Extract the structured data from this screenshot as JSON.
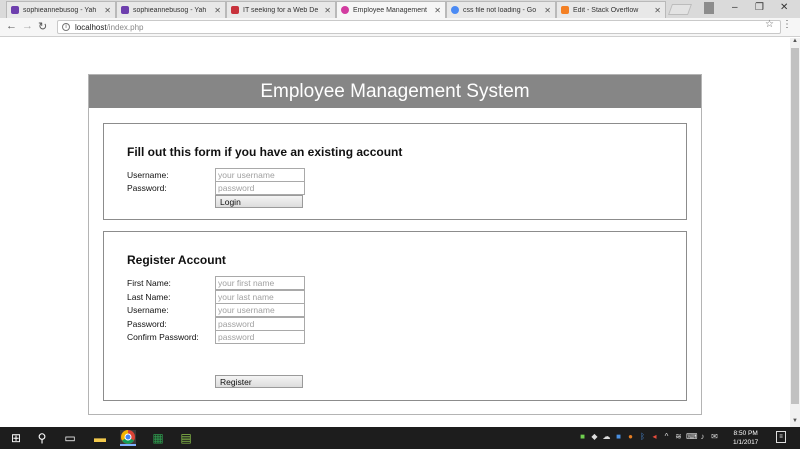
{
  "browser": {
    "tabs": [
      {
        "title": "sophieannebusog - Yah",
        "icon_color": "#6e3fae"
      },
      {
        "title": "sophieannebusog - Yah",
        "icon_color": "#6e3fae"
      },
      {
        "title": "IT seeking for a Web De",
        "icon_color": "#c8323c"
      },
      {
        "title": "Employee Management",
        "icon_color": "#d23ca0"
      },
      {
        "title": "css file not loading - Go",
        "icon_color": "#4a8af4"
      },
      {
        "title": "Edit - Stack Overflow",
        "icon_color": "#f48024"
      }
    ],
    "active_tab_index": 3,
    "url_host": "localhost",
    "url_path": "/index.php"
  },
  "page": {
    "header": "Employee Management System",
    "login": {
      "heading": "Fill out this form if you have an existing account",
      "fields": [
        {
          "label": "Username:",
          "placeholder": "your username",
          "value": ""
        },
        {
          "label": "Password:",
          "placeholder": "password",
          "value": ""
        }
      ],
      "button": "Login"
    },
    "register": {
      "heading": "Register Account",
      "fields": [
        {
          "label": "First Name:",
          "placeholder": "your first name",
          "value": ""
        },
        {
          "label": "Last Name:",
          "placeholder": "your last name",
          "value": ""
        },
        {
          "label": "Username:",
          "placeholder": "your username",
          "value": ""
        },
        {
          "label": "Password:",
          "placeholder": "password",
          "value": ""
        },
        {
          "label": "Confirm Password:",
          "placeholder": "password",
          "value": ""
        }
      ],
      "button": "Register"
    }
  },
  "taskbar": {
    "time": "8:50 PM",
    "date": "1/1/2017",
    "pinned": [
      "windows-start",
      "search",
      "task-view",
      "file-explorer",
      "chrome",
      "excel",
      "notepad"
    ],
    "tray": [
      "shield",
      "cloud",
      "onedrive",
      "network-badge",
      "bluetooth",
      "sound-muted",
      "wifi",
      "keyboard",
      "volume",
      "chat"
    ]
  },
  "colors": {
    "header_bg": "#868686",
    "header_text": "#ffffff",
    "box_border": "#8c8c8c",
    "taskbar_bg": "#1d1d1d"
  }
}
